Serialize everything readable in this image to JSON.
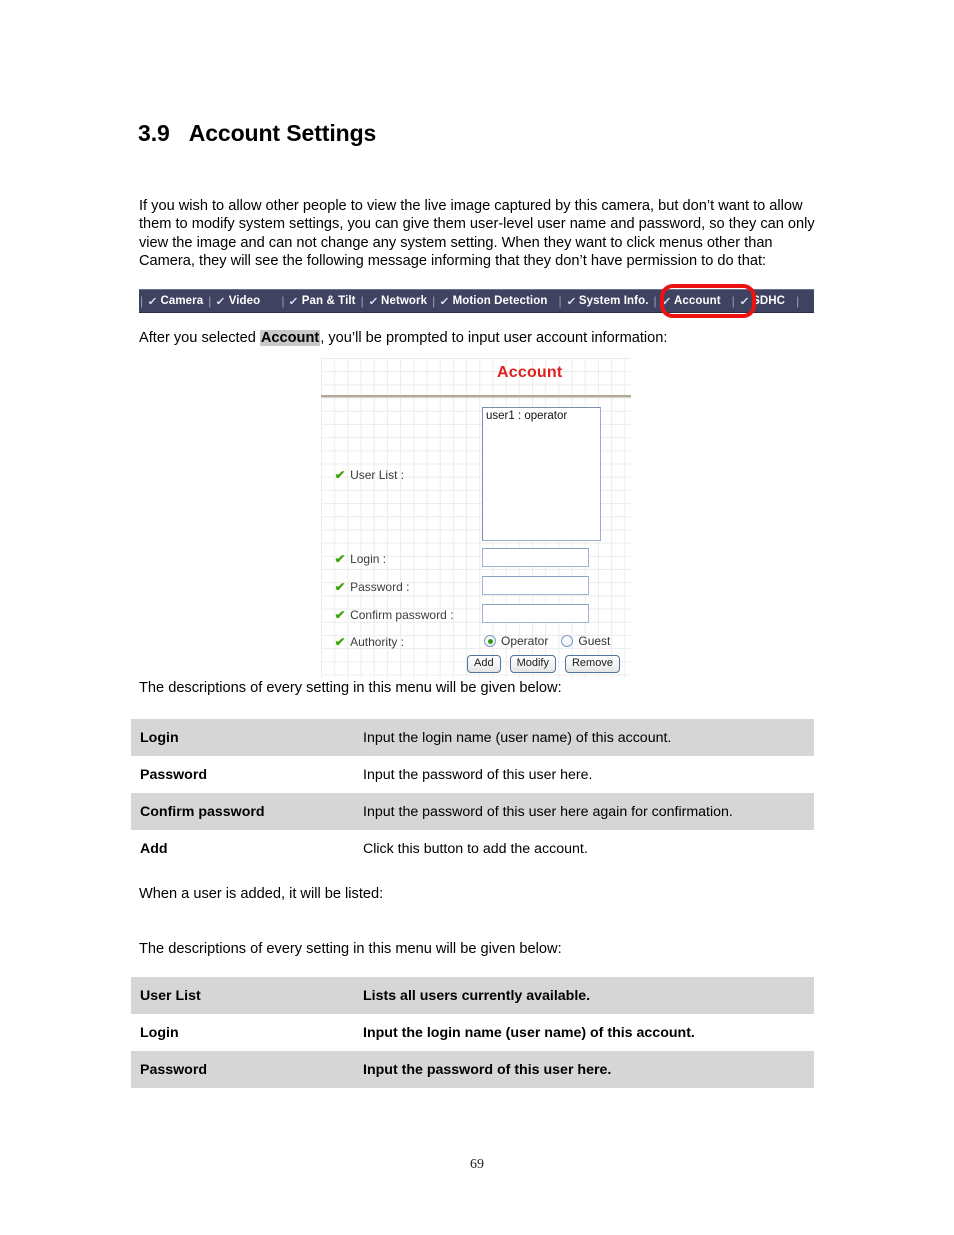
{
  "heading": {
    "number": "3.9",
    "title": "Account Settings"
  },
  "intro_paragraph": "If you wish to allow other people to view the live image captured by this camera, but don’t want to allow them to modify system settings, you can give them user-level user name and password, so they can only view the image and can not change any system setting. When they want to click menus other than Camera, they will see the following message informing that they don’t have permission to do that:",
  "navbar": {
    "items": [
      {
        "label": "Camera",
        "icon": "check-icon"
      },
      {
        "label": "Video",
        "icon": "check-icon"
      },
      {
        "label": "Pan & Tilt",
        "icon": "check-icon"
      },
      {
        "label": "Network",
        "icon": "check-icon"
      },
      {
        "label": "Motion Detection",
        "icon": "check-icon"
      },
      {
        "label": "System Info.",
        "icon": "check-icon"
      },
      {
        "label": "Account",
        "icon": "check-icon"
      },
      {
        "label": "SDHC",
        "icon": "check-icon"
      }
    ],
    "separator": "|",
    "highlighted_item": "Account",
    "highlight_color": "#ee1111",
    "bar_color": "#3f4361"
  },
  "after_selected": {
    "prefix": "After you selected ",
    "highlighted": "Account",
    "suffix": ", you’ll be prompted to input user account information:"
  },
  "account_panel": {
    "title": "Account",
    "title_color": "#e02020",
    "labels": {
      "user_list": "User List :",
      "login": "Login :",
      "password": "Password :",
      "confirm_password": "Confirm password :",
      "authority": "Authority :"
    },
    "user_list_items": [
      "user1 : operator"
    ],
    "fields": {
      "login_value": "",
      "password_value": "",
      "confirm_password_value": ""
    },
    "authority": {
      "options": [
        "Operator",
        "Guest"
      ],
      "selected": "Operator"
    },
    "buttons": [
      "Add",
      "Modify",
      "Remove"
    ]
  },
  "text_lines": {
    "desc_intro_1": "The descriptions of every setting in this menu will be given below:",
    "when_added": "When a user is added, it will be listed:",
    "desc_intro_2": "The descriptions of every setting in this menu will be given below:"
  },
  "table_one": {
    "rows": [
      {
        "key": "Login",
        "value": "Input the login name (user name) of this account."
      },
      {
        "key": "Password",
        "value": "Input the password of this user here."
      },
      {
        "key": "Confirm password",
        "value": "Input the password of this user here again for confirmation."
      },
      {
        "key": "Add",
        "value": "Click this button to add the account."
      }
    ]
  },
  "table_two": {
    "rows": [
      {
        "key": "User List",
        "value": "Lists all users currently available."
      },
      {
        "key": "Login",
        "value": "Input the login name (user name) of this account."
      },
      {
        "key": "Password",
        "value": "Input the password of this user here."
      }
    ]
  },
  "page_number": "69"
}
